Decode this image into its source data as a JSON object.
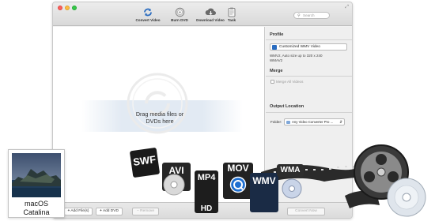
{
  "toolbar": {
    "items": [
      {
        "label": "Convert Video",
        "icon": "convert-icon"
      },
      {
        "label": "Burn DVD",
        "icon": "disc-icon"
      },
      {
        "label": "Download Video",
        "icon": "cloud-download-icon"
      },
      {
        "label": "Task",
        "icon": "task-icon"
      }
    ],
    "search_placeholder": "Search"
  },
  "drop_area": {
    "text_line1": "Drag media files or",
    "text_line2": "DVDs here"
  },
  "panel": {
    "profile_title": "Profile",
    "profile_value": "Customized WMV Video",
    "profile_desc_line1": "WMV2, Auto size up to 320 x 240",
    "profile_desc_line2": "WMAV2",
    "merge_title": "Merge",
    "merge_all_label": "Merge All Videos",
    "output_title": "Output Location",
    "folder_label": "Folder:",
    "folder_value": "Any Video Converter Pro ..."
  },
  "bottom_bar": {
    "add_files": "Add File(s)",
    "add_dvd": "Add DVD",
    "remove": "Remove",
    "convert_now": "Convert Now"
  },
  "badge": {
    "line1": "macOS",
    "line2": "Catalina"
  },
  "formats": {
    "swf": "SWF",
    "avi": "AVI",
    "mp4": "MP4",
    "hd": "HD",
    "mov": "MOV",
    "wmv": "WMV",
    "wma": "WMA"
  },
  "colors": {
    "accent_blue": "#2a6cc0",
    "window_bg": "#f2f2f2",
    "panel_bg": "#efefef"
  }
}
